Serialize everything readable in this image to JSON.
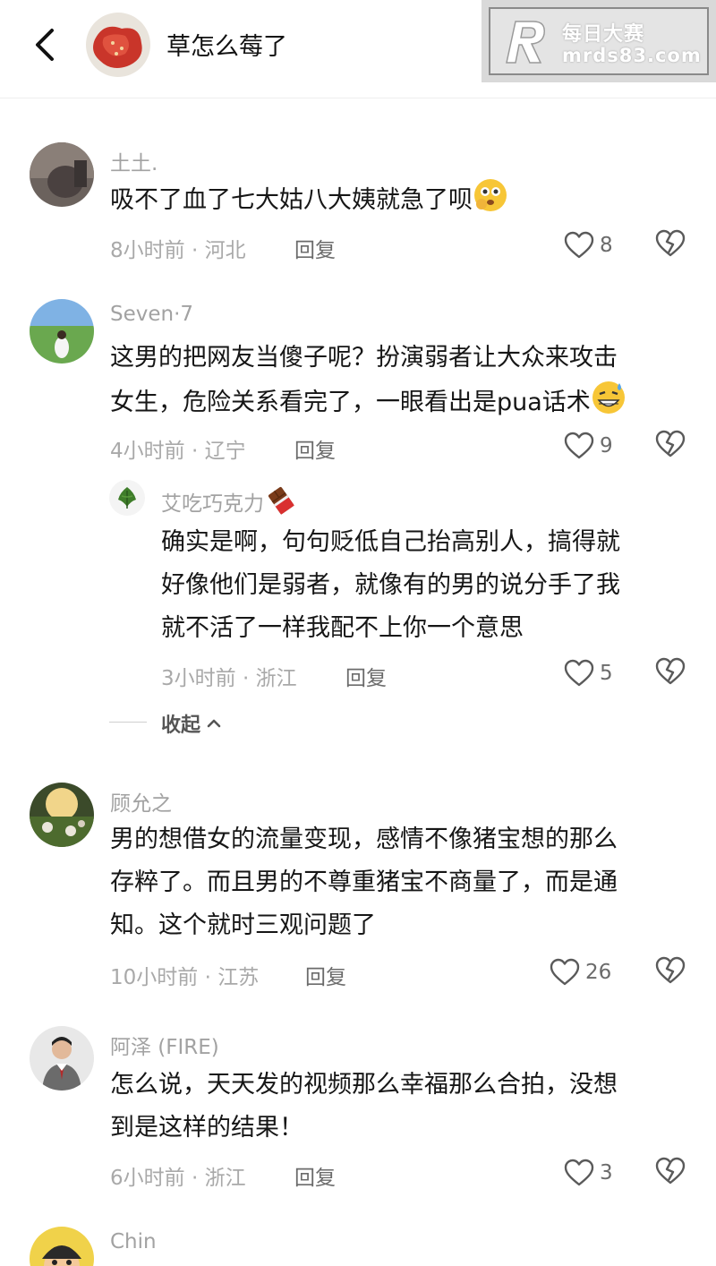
{
  "header": {
    "title": "草怎么莓了"
  },
  "watermark": {
    "brand": "每日大赛",
    "domain": "mrds83.com"
  },
  "comments": [
    {
      "username": "土土.",
      "text": "吸不了血了七大姑八大姨就急了呗",
      "emoji": "thinking-face-emoji",
      "time_location": "8小时前 · 河北",
      "reply_label": "回复",
      "likes": "8"
    },
    {
      "username": "Seven·7",
      "text_line1": "这男的把网友当傻子呢？扮演弱者让大众来攻击",
      "text_line2": "女生，危险关系看完了，一眼看出是pua话术",
      "emoji": "grinning-sweat-emoji",
      "time_location": "4小时前 · 辽宁",
      "reply_label": "回复",
      "likes": "9"
    },
    {
      "username": "艾吃巧克力",
      "emoji": "chocolate-bar-emoji",
      "text_line1": "确实是啊，句句贬低自己抬高别人，搞得就",
      "text_line2": "好像他们是弱者，就像有的男的说分手了我",
      "text_line3": "就不活了一样我配不上你一个意思",
      "time_location": "3小时前 · 浙江",
      "reply_label": "回复",
      "likes": "5"
    },
    {
      "username": "顾允之",
      "text_line1": "男的想借女的流量变现，感情不像猪宝想的那么",
      "text_line2": "存粹了。而且男的不尊重猪宝不商量了，而是通",
      "text_line3": "知。这个就时三观问题了",
      "time_location": "10小时前 · 江苏",
      "reply_label": "回复",
      "likes": "26"
    },
    {
      "username": "阿泽 (FIRE)",
      "text_line1": "怎么说，天天发的视频那么幸福那么合拍，没想",
      "text_line2": "到是这样的结果！",
      "time_location": "6小时前 · 浙江",
      "reply_label": "回复",
      "likes": "3"
    },
    {
      "username": "Chin"
    }
  ],
  "collapse_label": "收起"
}
